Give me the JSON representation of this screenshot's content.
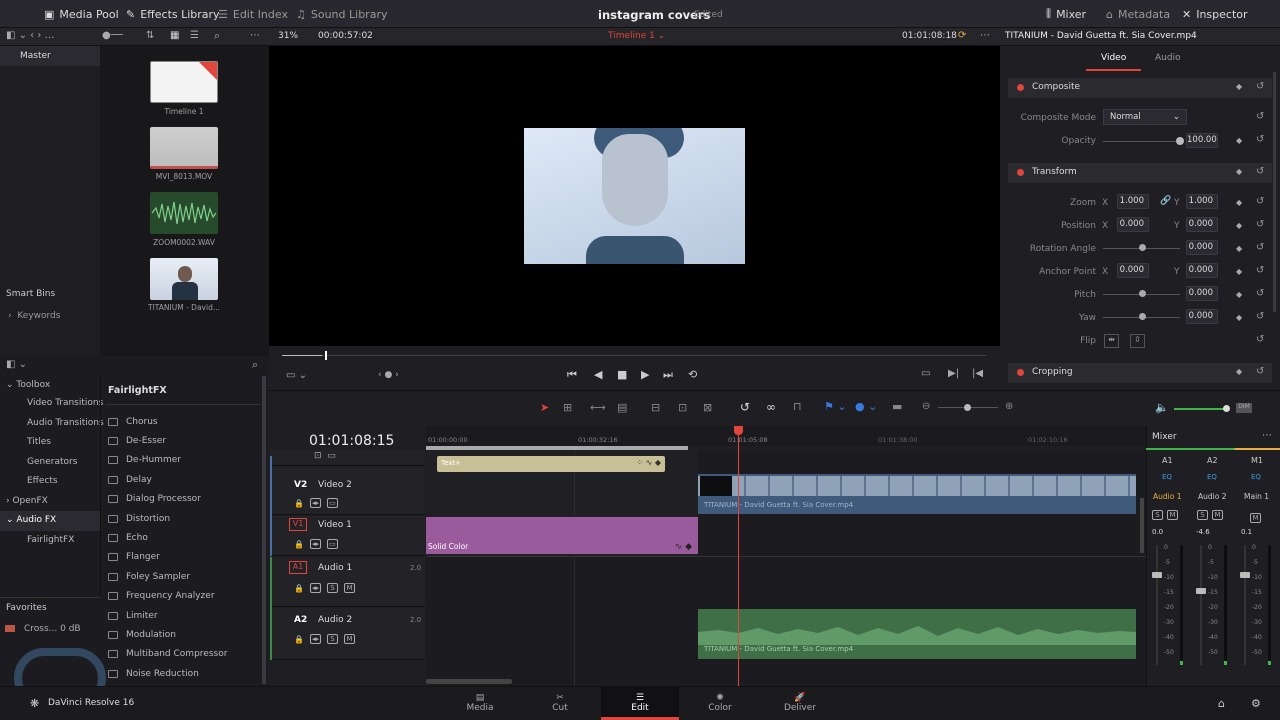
{
  "topbar": {
    "media_pool": "Media Pool",
    "effects_library": "Effects Library",
    "edit_index": "Edit Index",
    "sound_library": "Sound Library",
    "project_title": "instagram covers",
    "project_status": "Edited",
    "mixer": "Mixer",
    "metadata": "Metadata",
    "inspector": "Inspector"
  },
  "viewer_bar": {
    "zoom": "31%",
    "timecode_duration": "00:00:57:02",
    "timeline_name": "Timeline 1",
    "timecode_current": "01:01:08:18",
    "clip_name": "TITANIUM - David Guetta ft. Sia Cover.mp4"
  },
  "media_pool": {
    "master_label": "Master",
    "smart_bins_label": "Smart Bins",
    "keywords_label": "Keywords",
    "clips": [
      {
        "name": "Timeline 1"
      },
      {
        "name": "MVI_8013.MOV"
      },
      {
        "name": "ZOOM0002.WAV"
      },
      {
        "name": "TITANIUM - David..."
      }
    ]
  },
  "effects": {
    "toolbox_label": "Toolbox",
    "tree": [
      "Video Transitions",
      "Audio Transitions",
      "Titles",
      "Generators",
      "Effects"
    ],
    "openfx": "OpenFX",
    "audiofx": "Audio FX",
    "fairlightfx_tree": "FairlightFX",
    "fairlightfx_header": "FairlightFX",
    "items": [
      "Chorus",
      "De-Esser",
      "De-Hummer",
      "Delay",
      "Dialog Processor",
      "Distortion",
      "Echo",
      "Flanger",
      "Foley Sampler",
      "Frequency Analyzer",
      "Limiter",
      "Modulation",
      "Multiband Compressor",
      "Noise Reduction"
    ],
    "favorites_label": "Favorites",
    "favorite_item": "Cross... 0 dB"
  },
  "inspector": {
    "tab_video": "Video",
    "tab_audio": "Audio",
    "composite_header": "Composite",
    "composite_mode_label": "Composite Mode",
    "composite_mode_value": "Normal",
    "opacity_label": "Opacity",
    "opacity_value": "100.00",
    "opacity_level": 1.0,
    "transform_header": "Transform",
    "zoom_label": "Zoom",
    "zoom_x": "1.000",
    "zoom_y": "1.000",
    "position_label": "Position",
    "position_x": "0.000",
    "position_y": "0.000",
    "rotation_label": "Rotation Angle",
    "rotation_value": "0.000",
    "anchor_label": "Anchor Point",
    "anchor_x": "0.000",
    "anchor_y": "0.000",
    "pitch_label": "Pitch",
    "pitch_value": "0.000",
    "yaw_label": "Yaw",
    "yaw_value": "0.000",
    "flip_label": "Flip",
    "cropping_header": "Cropping",
    "x_letter": "X",
    "y_letter": "Y"
  },
  "timeline": {
    "timecode": "01:01:08:15",
    "ruler": [
      "01:00:00:00",
      "01:00:32:16",
      "01:01:05:08",
      "01:01:38:00",
      "01:02:10:16"
    ],
    "tracks": {
      "v2_id": "V2",
      "v2_name": "Video 2",
      "v1_id": "V1",
      "v1_name": "Video 1",
      "a1_id": "A1",
      "a1_name": "Audio 1",
      "a1_level": "2.0",
      "a2_id": "A2",
      "a2_name": "Audio 2",
      "a2_level": "2.0"
    },
    "clips": {
      "text_clip": "Text+",
      "solid_color": "Solid Color",
      "video_clip": "TITANIUM - David Guetta ft. Sia Cover.mp4",
      "audio_clip": "TITANIUM - David Guetta ft. Sia Cover.mp4"
    },
    "s_label": "S",
    "m_label": "M"
  },
  "mixer": {
    "title": "Mixer",
    "channels": [
      "A1",
      "A2",
      "M1"
    ],
    "eq_label": "EQ",
    "strip_names": [
      "Audio 1",
      "Audio 2",
      "Main 1"
    ],
    "strip_values": [
      "0.0",
      "-4.6",
      "0.1"
    ],
    "scale": [
      "0",
      "-5",
      "-10",
      "-15",
      "-20",
      "-30",
      "-40",
      "-50"
    ]
  },
  "pages": [
    "Media",
    "Cut",
    "Edit",
    "Color",
    "Deliver"
  ],
  "app_name": "DaVinci Resolve 16",
  "colors": {
    "accent_red": "#e0463c",
    "timeline_playhead": "#e0463c",
    "solid_color_clip": "#9a5b9c",
    "audio_clip": "#3f6f47",
    "video_clip": "#3f5a7a"
  }
}
